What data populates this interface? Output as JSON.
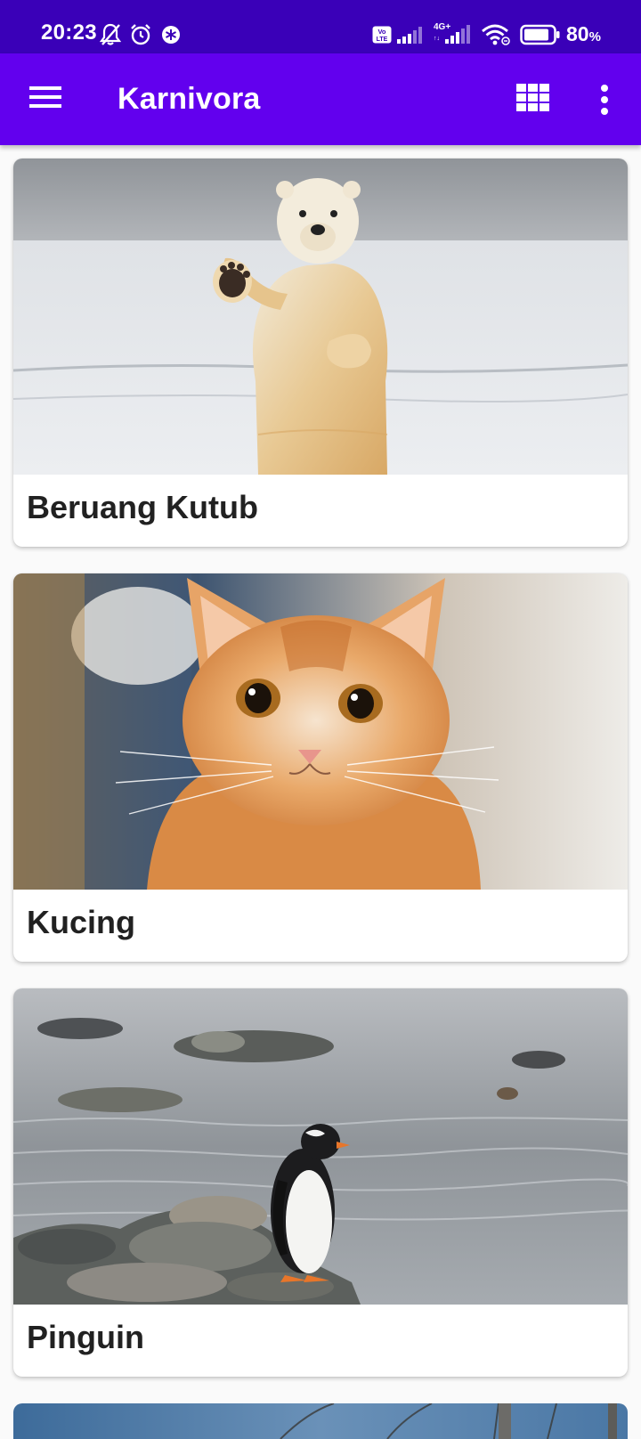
{
  "status_bar": {
    "time": "20:23",
    "battery_value": "80",
    "battery_unit": "%",
    "network_label": "4G+",
    "volte_label": "Vo LTE",
    "icons": [
      "mute-bell-icon",
      "alarm-icon",
      "app-notification-icon",
      "volte-icon",
      "signal-icon",
      "4g-signal-icon",
      "wifi-icon",
      "battery-icon"
    ]
  },
  "app_bar": {
    "title": "Karnivora",
    "icons": [
      "menu-icon",
      "grid-view-icon",
      "more-options-icon"
    ],
    "background_color": "#6200ee"
  },
  "cards": [
    {
      "title": "Beruang Kutub",
      "image": "polar-bear-photo"
    },
    {
      "title": "Kucing",
      "image": "cat-photo"
    },
    {
      "title": "Pinguin",
      "image": "penguin-photo"
    }
  ],
  "colors": {
    "status_bar": "#3a00b8",
    "app_bar": "#6200ee",
    "card_title": "#212121",
    "background": "#fafafa"
  }
}
